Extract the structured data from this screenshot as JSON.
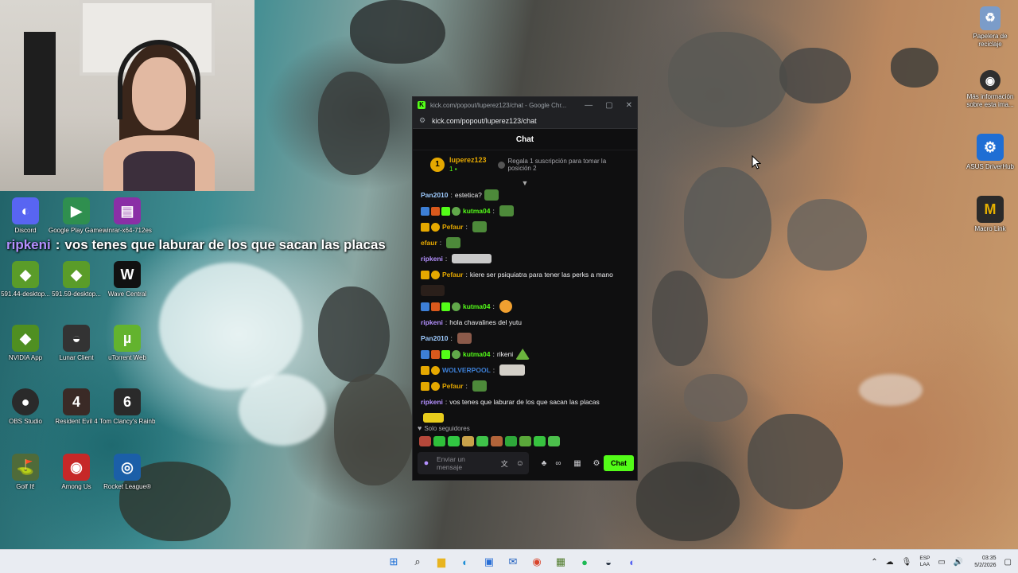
{
  "webcam": {
    "label": "streamer webcam"
  },
  "desktop_icons": [
    {
      "id": "discord",
      "label": "Discord",
      "glyph": "◐",
      "color": "#5865f2"
    },
    {
      "id": "google-play",
      "label": "Google Play Games",
      "glyph": "▶",
      "color": "#2f8f4f"
    },
    {
      "id": "winrar",
      "label": "winrar-x64-712es",
      "glyph": "▤",
      "color": "#8a2fa6"
    },
    {
      "id": "geforce1",
      "label": "591.44-desktop...",
      "glyph": "◆",
      "color": "#5a9c29"
    },
    {
      "id": "geforce2",
      "label": "591.59-desktop...",
      "glyph": "◆",
      "color": "#5a9c29"
    },
    {
      "id": "wave",
      "label": "Wave Central",
      "glyph": "W",
      "color": "#111111"
    },
    {
      "id": "nvidia",
      "label": "NVIDIA App",
      "glyph": "◆",
      "color": "#4f8f21"
    },
    {
      "id": "lunar",
      "label": "Lunar Client",
      "glyph": "◒",
      "color": "#333333"
    },
    {
      "id": "utorrent",
      "label": "uTorrent Web",
      "glyph": "µ",
      "color": "#63b32e"
    },
    {
      "id": "obs",
      "label": "OBS Studio",
      "glyph": "●",
      "color": "#2a2a2a"
    },
    {
      "id": "re4",
      "label": "Resident Evil 4",
      "glyph": "4",
      "color": "#3a2a26"
    },
    {
      "id": "r6",
      "label": "Tom Clancy's Rainbow Six...",
      "glyph": "6",
      "color": "#2a2a2a"
    },
    {
      "id": "golfit",
      "label": "Golf It!",
      "glyph": "⛳",
      "color": "#4f6b3a"
    },
    {
      "id": "amongus",
      "label": "Among Us",
      "glyph": "◉",
      "color": "#c62828"
    },
    {
      "id": "rocket",
      "label": "Rocket League®",
      "glyph": "◎",
      "color": "#1b5fa8"
    },
    {
      "id": "recycle",
      "label": "Papelera de reciclaje",
      "glyph": "♻",
      "color": "#7b9cc9"
    },
    {
      "id": "info",
      "label": "Más información sobre esta ima...",
      "glyph": "◉",
      "color": "#2f2f2f"
    },
    {
      "id": "asus",
      "label": "ASUS DriverHub",
      "glyph": "⚙",
      "color": "#1f6ed4"
    },
    {
      "id": "mocro",
      "label": "Macro Link",
      "glyph": "M",
      "color": "#2a2a2a"
    }
  ],
  "overlay": {
    "user": "ripkeni",
    "sep": ":",
    "text": "vos tenes que laburar de los que sacan las placas"
  },
  "popout": {
    "window_title": "kick.com/popout/luperez123/chat - Google Chr...",
    "url": "kick.com/popout/luperez123/chat",
    "controls": [
      "—",
      "▢",
      "✕"
    ],
    "chat_title": "Chat",
    "pinned": {
      "user": "luperez123",
      "count": "1",
      "gift_text": "Regala 1 suscripción para tomar la posición 2"
    },
    "messages": [
      {
        "badges": [],
        "user": "Pan2010",
        "color": "#9ecbff",
        "text": "estetica?",
        "emotes": [
          "e-frog"
        ]
      },
      {
        "badges": [
          "b-blue",
          "b-orange",
          "b-green",
          "b-frog"
        ],
        "user": "kutma04",
        "color": "#53fc18",
        "text": "",
        "emotes": [
          "e-frog"
        ]
      },
      {
        "badges": [
          "b-gold",
          "b-sub"
        ],
        "user": "Pefaur",
        "color": "#e5a800",
        "text": "",
        "emotes": [
          "e-frog"
        ]
      },
      {
        "badges": [],
        "user": "efaur",
        "color": "#e5a800",
        "text": "",
        "emotes": [
          "e-frog"
        ]
      },
      {
        "badges": [],
        "user": "ripkeni",
        "color": "#b490ff",
        "text": "",
        "emotes": [
          "e-grey"
        ]
      },
      {
        "badges": [
          "b-gold",
          "b-sub"
        ],
        "user": "Pefaur",
        "color": "#e5a800",
        "text": "kiere ser psiquiatra para tener las perks a mano",
        "emotes": []
      },
      {
        "badges": [
          "b-blue",
          "b-orange",
          "b-green",
          "b-frog"
        ],
        "user": "kutma04",
        "color": "#53fc18",
        "text": "",
        "emotes": [
          "e-angry"
        ]
      },
      {
        "badges": [],
        "user": "ripkeni",
        "color": "#b490ff",
        "text": "hola chavalines del yutu",
        "emotes": []
      },
      {
        "badges": [],
        "user": "Pan2010",
        "color": "#9ecbff",
        "text": "",
        "emotes": [
          "e-pic"
        ]
      },
      {
        "badges": [
          "b-blue",
          "b-orange",
          "b-green",
          "b-frog"
        ],
        "user": "kutma04",
        "color": "#53fc18",
        "text": "rikeni",
        "emotes": [
          "e-cone"
        ]
      },
      {
        "badges": [
          "b-gold",
          "b-sub"
        ],
        "user": "WOLVERPOOL",
        "color": "#3d7fd6",
        "text": "",
        "emotes": [
          "e-dog"
        ]
      },
      {
        "badges": [
          "b-gold",
          "b-sub"
        ],
        "user": "Pefaur",
        "color": "#e5a800",
        "text": "",
        "emotes": [
          "e-frog"
        ]
      },
      {
        "badges": [],
        "user": "ripkeni",
        "color": "#b490ff",
        "text": "vos tenes que laburar de los que sacan las placas",
        "emotes": []
      }
    ],
    "followers_mode": "Solo seguidores",
    "emote_bar_colors": [
      "#b5483a",
      "#2fbf3a",
      "#31c742",
      "#c9a24a",
      "#3fc34a",
      "#b2643a",
      "#2ea83a",
      "#5aa83a",
      "#37c33f",
      "#4cc04c"
    ],
    "input_placeholder": "Enviar un mensaje",
    "send_label": "Chat"
  },
  "taskbar": {
    "apps": [
      {
        "name": "start",
        "glyph": "⊞",
        "color": "#1c6fd6"
      },
      {
        "name": "search",
        "glyph": "⌕",
        "color": "#222222"
      },
      {
        "name": "explorer",
        "glyph": "▆",
        "color": "#e8b420"
      },
      {
        "name": "edge",
        "glyph": "◐",
        "color": "#1f8fd6"
      },
      {
        "name": "store",
        "glyph": "▣",
        "color": "#2a6fd6"
      },
      {
        "name": "outlook",
        "glyph": "✉",
        "color": "#1f5fbf"
      },
      {
        "name": "chrome",
        "glyph": "◉",
        "color": "#d9452c"
      },
      {
        "name": "minecraft",
        "glyph": "▦",
        "color": "#4f7a2a"
      },
      {
        "name": "spotify",
        "glyph": "●",
        "color": "#1db954"
      },
      {
        "name": "steam",
        "glyph": "◒",
        "color": "#1b2838"
      },
      {
        "name": "discord",
        "glyph": "◐",
        "color": "#5865f2"
      }
    ],
    "tray": {
      "lang_top": "ESP",
      "lang_bottom": "LAA",
      "time": "03:35",
      "date": "5/2/2026"
    }
  }
}
